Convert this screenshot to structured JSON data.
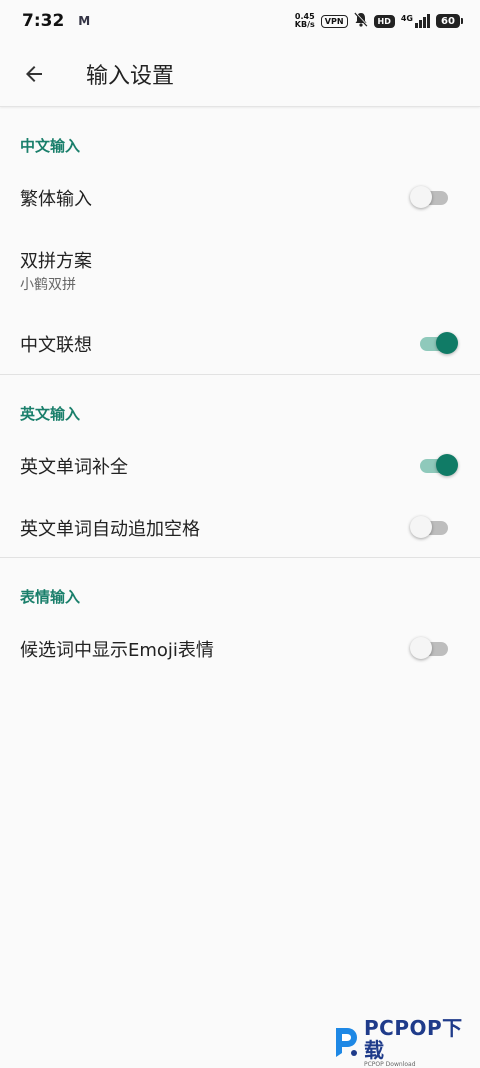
{
  "status_bar": {
    "time": "7:32",
    "mail_icon": "M",
    "net_speed_value": "0.45",
    "net_speed_unit": "KB/s",
    "vpn": "VPN",
    "hd": "HD",
    "network": "4G",
    "battery": "60"
  },
  "toolbar": {
    "title": "输入设置",
    "back_icon": "arrow-left-icon"
  },
  "sections": [
    {
      "header": "中文输入",
      "rows": [
        {
          "title": "繁体输入",
          "switch": false
        },
        {
          "title": "双拼方案",
          "summary": "小鹤双拼"
        },
        {
          "title": "中文联想",
          "switch": true
        }
      ]
    },
    {
      "header": "英文输入",
      "rows": [
        {
          "title": "英文单词补全",
          "switch": true
        },
        {
          "title": "英文单词自动追加空格",
          "switch": false
        }
      ]
    },
    {
      "header": "表情输入",
      "rows": [
        {
          "title": "候选词中显示Emoji表情",
          "switch": false
        }
      ]
    }
  ],
  "colors": {
    "accent": "#107b66",
    "accent_track": "#8fc9bb",
    "header_text": "#1a7f6b"
  },
  "watermark": {
    "main": "PCPOP下载",
    "sub": "PCPOP Download"
  }
}
